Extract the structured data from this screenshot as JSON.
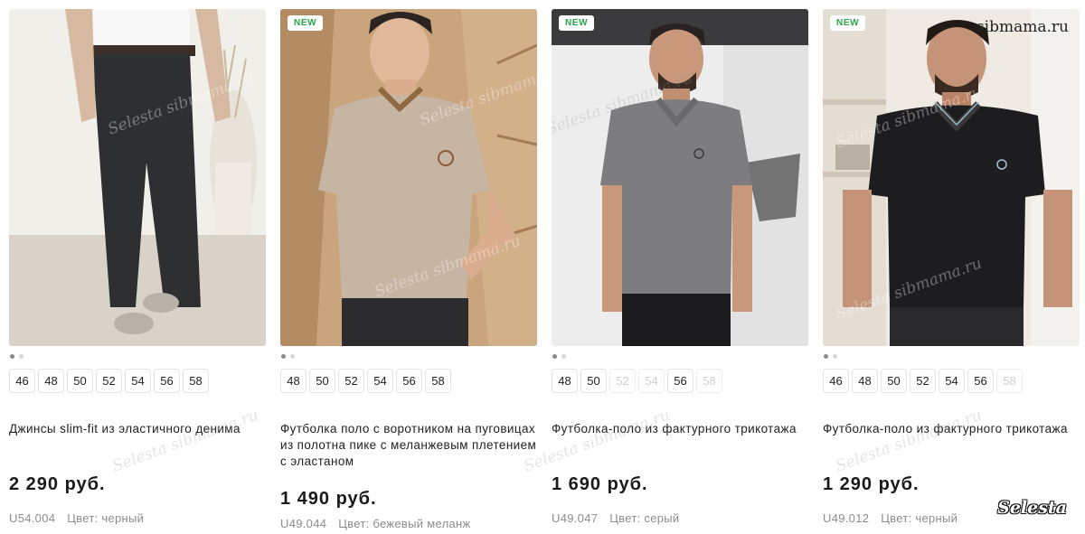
{
  "products": [
    {
      "badge": "",
      "title": "Джинсы slim-fit из эластичного денима",
      "price": "2 290 руб.",
      "sku": "U54.004",
      "color_label": "Цвет: черный",
      "sizes": [
        {
          "label": "46",
          "available": true
        },
        {
          "label": "48",
          "available": true
        },
        {
          "label": "50",
          "available": true
        },
        {
          "label": "52",
          "available": true
        },
        {
          "label": "54",
          "available": true
        },
        {
          "label": "56",
          "available": true
        },
        {
          "label": "58",
          "available": true
        }
      ],
      "image_icon": "jeans-photo"
    },
    {
      "badge": "NEW",
      "title": "Футболка поло с воротником на пуговицах из полотна пике с меланжевым плетением с эластаном",
      "price": "1 490 руб.",
      "sku": "U49.044",
      "color_label": "Цвет: бежевый меланж",
      "sizes": [
        {
          "label": "48",
          "available": true
        },
        {
          "label": "50",
          "available": true
        },
        {
          "label": "52",
          "available": true
        },
        {
          "label": "54",
          "available": true
        },
        {
          "label": "56",
          "available": true
        },
        {
          "label": "58",
          "available": true
        }
      ],
      "image_icon": "beige-polo-photo"
    },
    {
      "badge": "NEW",
      "title": "Футболка-поло из фактурного трикотажа",
      "price": "1 690 руб.",
      "sku": "U49.047",
      "color_label": "Цвет: серый",
      "sizes": [
        {
          "label": "48",
          "available": true
        },
        {
          "label": "50",
          "available": true
        },
        {
          "label": "52",
          "available": false
        },
        {
          "label": "54",
          "available": false
        },
        {
          "label": "56",
          "available": true
        },
        {
          "label": "58",
          "available": false
        }
      ],
      "image_icon": "grey-polo-photo"
    },
    {
      "badge": "NEW",
      "title": "Футболка-поло из фактурного трикотажа",
      "price": "1 290 руб.",
      "sku": "U49.012",
      "color_label": "Цвет: черный",
      "sizes": [
        {
          "label": "46",
          "available": true
        },
        {
          "label": "48",
          "available": true
        },
        {
          "label": "50",
          "available": true
        },
        {
          "label": "52",
          "available": true
        },
        {
          "label": "54",
          "available": true
        },
        {
          "label": "56",
          "available": true
        },
        {
          "label": "58",
          "available": false
        }
      ],
      "image_icon": "black-polo-photo"
    }
  ],
  "watermarks": {
    "site": "sibmama.ru",
    "brand": "Selesta",
    "diagonal": "Selesta sibmama.ru"
  },
  "colors": {
    "badge_text": "#2aa54a",
    "price": "#1a1a1a",
    "meta": "#8c8c8c",
    "size_unavailable": "#cfcfcf"
  }
}
